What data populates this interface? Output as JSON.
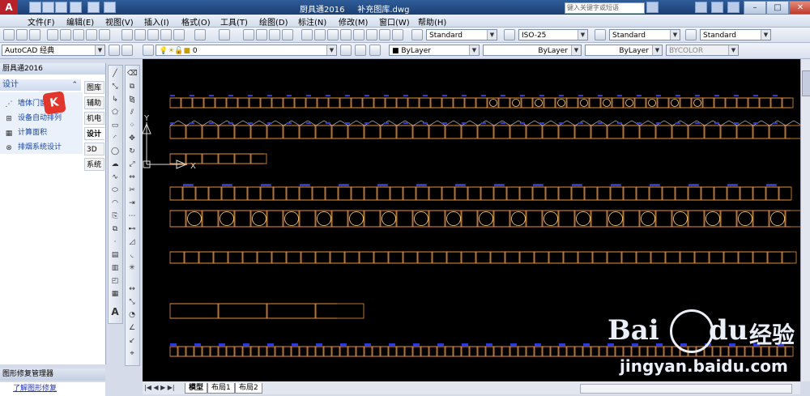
{
  "title": {
    "app": "厨具通2016",
    "file": "补充图库.dwg"
  },
  "search": {
    "placeholder": "键入关键字或短语"
  },
  "menus": [
    "文件(F)",
    "编辑(E)",
    "视图(V)",
    "插入(I)",
    "格式(O)",
    "工具(T)",
    "绘图(D)",
    "标注(N)",
    "修改(M)",
    "窗口(W)",
    "帮助(H)"
  ],
  "styles": {
    "text": "Standard",
    "dim": "ISO-25",
    "table": "Standard",
    "mleader": "Standard"
  },
  "workspace": "AutoCAD 经典",
  "layer": {
    "current": "0",
    "color": "ByLayer",
    "linetype": "ByLayer",
    "lineweight": "ByLayer",
    "plotstyle": "BYCOLOR"
  },
  "panel": {
    "title": "厨具通2016",
    "section": "设计",
    "items": [
      {
        "label": "墙体门窗",
        "icon": "wall-icon"
      },
      {
        "label": "设备自动排列",
        "icon": "grid-icon"
      },
      {
        "label": "计算面积",
        "icon": "area-icon"
      },
      {
        "label": "排烟系统设计",
        "icon": "exhaust-icon"
      }
    ],
    "tabs": [
      "图库",
      "辅助",
      "机电",
      "设计",
      "3D",
      "系统"
    ],
    "active_tab": "设计"
  },
  "ucs": {
    "y": "Y",
    "x": "X"
  },
  "layout_tabs": [
    "模型",
    "布局1",
    "布局2"
  ],
  "repair": {
    "title": "图形修复管理器",
    "link": "了解图形修复"
  },
  "watermark": {
    "brand": "Bai",
    "brand2": "du",
    "cn": "经验",
    "url": "jingyan.baidu.com"
  }
}
